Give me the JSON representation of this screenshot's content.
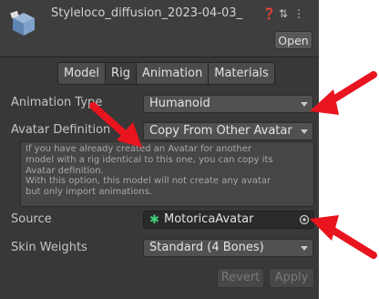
{
  "header": {
    "title": "Styleloco_diffusion_2023-04-03_",
    "icons": [
      "help-icon",
      "settings-sliders-icon",
      "kebab-menu-icon"
    ],
    "open_label": "Open"
  },
  "tabs": [
    {
      "label": "Model",
      "active": false
    },
    {
      "label": "Rig",
      "active": true
    },
    {
      "label": "Animation",
      "active": false
    },
    {
      "label": "Materials",
      "active": false
    }
  ],
  "fields": {
    "animation_type": {
      "label": "Animation Type",
      "value": "Humanoid"
    },
    "avatar_definition": {
      "label": "Avatar Definition",
      "value": "Copy From Other Avatar"
    },
    "info_text": "If you have already created an Avatar for another\nmodel with a rig identical to this one, you can copy its\nAvatar definition.\nWith this option, this model will not create any avatar\nbut only import animations.",
    "source": {
      "label": "Source",
      "value": "MotoricaAvatar"
    },
    "skin_weights": {
      "label": "Skin Weights",
      "value": "Standard (4 Bones)"
    }
  },
  "footer": {
    "revert_label": "Revert",
    "apply_label": "Apply"
  },
  "colors": {
    "annotation_arrow": "#e8141e",
    "panel_bg": "#383838",
    "avatar_icon": "#3fd07a"
  }
}
